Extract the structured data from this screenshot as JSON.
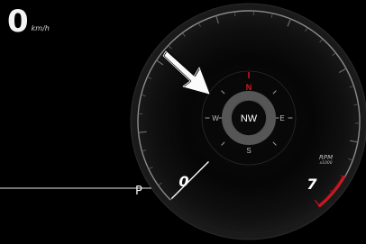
{
  "speedometer": {
    "value": "0",
    "unit": "km/h"
  },
  "transmission": {
    "gear": "P"
  },
  "tachometer": {
    "label": "RPM",
    "multiplier": "x1000",
    "start_value": "0",
    "end_value": "7",
    "needle_value": 0,
    "scale_max": 7,
    "redline_start": 6.5,
    "colors": {
      "redline": "#d0101c",
      "needle": "#ffffff",
      "glow": "#c81018"
    }
  },
  "compass": {
    "heading": "NW",
    "north": "N",
    "east": "E",
    "south": "S",
    "west": "W",
    "colors": {
      "north": "#e0141e",
      "ring": "#565656"
    }
  },
  "overlay": {
    "icon": "white-arrow-pointing-to-compass"
  }
}
